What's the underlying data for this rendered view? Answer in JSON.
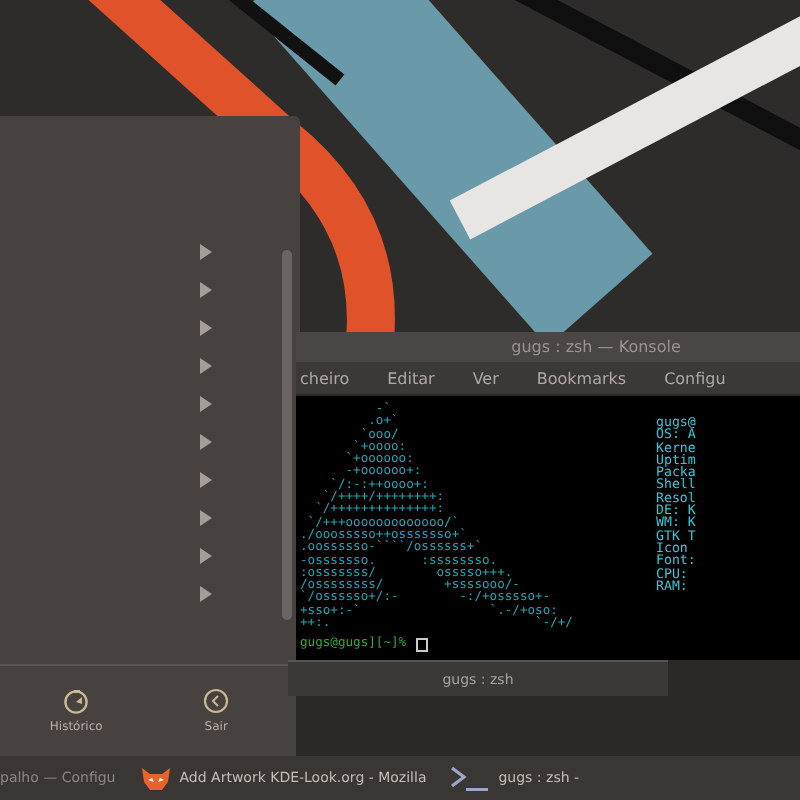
{
  "menu": {
    "submenus": [
      {
        "kind": "submenu"
      },
      {
        "kind": "submenu"
      },
      {
        "kind": "submenu"
      },
      {
        "kind": "submenu"
      },
      {
        "kind": "submenu"
      },
      {
        "kind": "submenu"
      },
      {
        "kind": "submenu"
      },
      {
        "kind": "submenu"
      },
      {
        "kind": "submenu"
      },
      {
        "kind": "submenu"
      }
    ],
    "tabs": [
      {
        "label": "Histórico",
        "kind": "history",
        "selected": false
      },
      {
        "label": "Sair",
        "kind": "leave",
        "selected": false
      }
    ]
  },
  "konsole": {
    "title": "gugs : zsh — Konsole",
    "menubar": [
      "cheiro",
      "Editar",
      "Ver",
      "Bookmarks",
      "Configu"
    ],
    "logo": [
      "          -`",
      "         .o+`",
      "        `ooo/",
      "       `+oooo:",
      "      `+oooooo:",
      "      -+oooooo+:",
      "    `/:-:++oooo+:",
      "   `/++++/++++++++:",
      "  `/++++++++++++++:",
      " `/+++ooooooooooooo/`",
      "./ooosssso++osssssso+`",
      ".oossssso-````/ossssss+`",
      "-osssssso.      :ssssssso.",
      ":osssssss/        osssso+++.",
      "/ossssssss/        +ssssooo/-",
      "`/ossssso+/:-        -:/+osssso+-",
      "+sso+:-`                 `.-/+oso:",
      "++:.                           `-/+/"
    ],
    "info": [
      "gugs@",
      "OS: A",
      "Kerne",
      "Uptim",
      "Packa",
      "Shell",
      "Resol",
      "DE: K",
      "WM: K",
      "GTK T",
      "Icon",
      "Font:",
      "CPU:",
      "RAM:"
    ],
    "prompt": "gugs@gugs][~]%",
    "tab": "gugs : zsh"
  },
  "taskbar": [
    {
      "kind": "settings",
      "label": "palho — Configu"
    },
    {
      "kind": "browser",
      "label": "Add  Artwork KDE-Look.org - Mozilla"
    },
    {
      "kind": "terminal",
      "label": "gugs : zsh -"
    }
  ]
}
